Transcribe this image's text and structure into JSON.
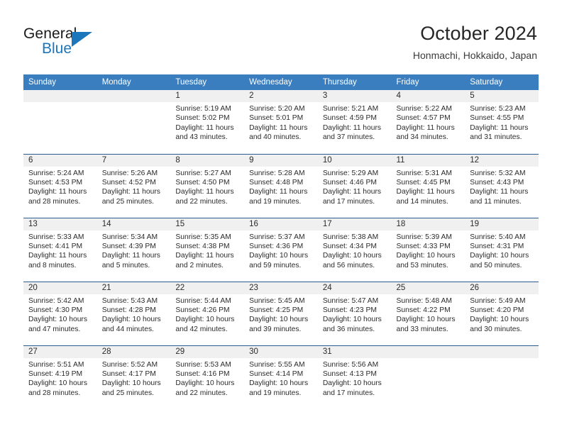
{
  "brand": {
    "name_part1": "General",
    "name_part2": "Blue",
    "logo_icon": "blue-triangle-icon",
    "colors": {
      "accent": "#1b76bc",
      "dark_text": "#1a1a1a"
    }
  },
  "header": {
    "title": "October 2024",
    "subtitle": "Honmachi, Hokkaido, Japan"
  },
  "theme": {
    "header_row_bg": "#3b7ebf",
    "header_row_text": "#ffffff",
    "row_divider": "#2b5c8f",
    "daynum_band_bg": "#f0f0f0",
    "page_bg": "#ffffff",
    "body_text": "#2b2b2b"
  },
  "calendar": {
    "weekday_headers": [
      "Sunday",
      "Monday",
      "Tuesday",
      "Wednesday",
      "Thursday",
      "Friday",
      "Saturday"
    ],
    "weeks": [
      [
        {
          "day": "",
          "lines": ""
        },
        {
          "day": "",
          "lines": ""
        },
        {
          "day": "1",
          "lines": "Sunrise: 5:19 AM\nSunset: 5:02 PM\nDaylight: 11 hours\nand 43 minutes."
        },
        {
          "day": "2",
          "lines": "Sunrise: 5:20 AM\nSunset: 5:01 PM\nDaylight: 11 hours\nand 40 minutes."
        },
        {
          "day": "3",
          "lines": "Sunrise: 5:21 AM\nSunset: 4:59 PM\nDaylight: 11 hours\nand 37 minutes."
        },
        {
          "day": "4",
          "lines": "Sunrise: 5:22 AM\nSunset: 4:57 PM\nDaylight: 11 hours\nand 34 minutes."
        },
        {
          "day": "5",
          "lines": "Sunrise: 5:23 AM\nSunset: 4:55 PM\nDaylight: 11 hours\nand 31 minutes."
        }
      ],
      [
        {
          "day": "6",
          "lines": "Sunrise: 5:24 AM\nSunset: 4:53 PM\nDaylight: 11 hours\nand 28 minutes."
        },
        {
          "day": "7",
          "lines": "Sunrise: 5:26 AM\nSunset: 4:52 PM\nDaylight: 11 hours\nand 25 minutes."
        },
        {
          "day": "8",
          "lines": "Sunrise: 5:27 AM\nSunset: 4:50 PM\nDaylight: 11 hours\nand 22 minutes."
        },
        {
          "day": "9",
          "lines": "Sunrise: 5:28 AM\nSunset: 4:48 PM\nDaylight: 11 hours\nand 19 minutes."
        },
        {
          "day": "10",
          "lines": "Sunrise: 5:29 AM\nSunset: 4:46 PM\nDaylight: 11 hours\nand 17 minutes."
        },
        {
          "day": "11",
          "lines": "Sunrise: 5:31 AM\nSunset: 4:45 PM\nDaylight: 11 hours\nand 14 minutes."
        },
        {
          "day": "12",
          "lines": "Sunrise: 5:32 AM\nSunset: 4:43 PM\nDaylight: 11 hours\nand 11 minutes."
        }
      ],
      [
        {
          "day": "13",
          "lines": "Sunrise: 5:33 AM\nSunset: 4:41 PM\nDaylight: 11 hours\nand 8 minutes."
        },
        {
          "day": "14",
          "lines": "Sunrise: 5:34 AM\nSunset: 4:39 PM\nDaylight: 11 hours\nand 5 minutes."
        },
        {
          "day": "15",
          "lines": "Sunrise: 5:35 AM\nSunset: 4:38 PM\nDaylight: 11 hours\nand 2 minutes."
        },
        {
          "day": "16",
          "lines": "Sunrise: 5:37 AM\nSunset: 4:36 PM\nDaylight: 10 hours\nand 59 minutes."
        },
        {
          "day": "17",
          "lines": "Sunrise: 5:38 AM\nSunset: 4:34 PM\nDaylight: 10 hours\nand 56 minutes."
        },
        {
          "day": "18",
          "lines": "Sunrise: 5:39 AM\nSunset: 4:33 PM\nDaylight: 10 hours\nand 53 minutes."
        },
        {
          "day": "19",
          "lines": "Sunrise: 5:40 AM\nSunset: 4:31 PM\nDaylight: 10 hours\nand 50 minutes."
        }
      ],
      [
        {
          "day": "20",
          "lines": "Sunrise: 5:42 AM\nSunset: 4:30 PM\nDaylight: 10 hours\nand 47 minutes."
        },
        {
          "day": "21",
          "lines": "Sunrise: 5:43 AM\nSunset: 4:28 PM\nDaylight: 10 hours\nand 44 minutes."
        },
        {
          "day": "22",
          "lines": "Sunrise: 5:44 AM\nSunset: 4:26 PM\nDaylight: 10 hours\nand 42 minutes."
        },
        {
          "day": "23",
          "lines": "Sunrise: 5:45 AM\nSunset: 4:25 PM\nDaylight: 10 hours\nand 39 minutes."
        },
        {
          "day": "24",
          "lines": "Sunrise: 5:47 AM\nSunset: 4:23 PM\nDaylight: 10 hours\nand 36 minutes."
        },
        {
          "day": "25",
          "lines": "Sunrise: 5:48 AM\nSunset: 4:22 PM\nDaylight: 10 hours\nand 33 minutes."
        },
        {
          "day": "26",
          "lines": "Sunrise: 5:49 AM\nSunset: 4:20 PM\nDaylight: 10 hours\nand 30 minutes."
        }
      ],
      [
        {
          "day": "27",
          "lines": "Sunrise: 5:51 AM\nSunset: 4:19 PM\nDaylight: 10 hours\nand 28 minutes."
        },
        {
          "day": "28",
          "lines": "Sunrise: 5:52 AM\nSunset: 4:17 PM\nDaylight: 10 hours\nand 25 minutes."
        },
        {
          "day": "29",
          "lines": "Sunrise: 5:53 AM\nSunset: 4:16 PM\nDaylight: 10 hours\nand 22 minutes."
        },
        {
          "day": "30",
          "lines": "Sunrise: 5:55 AM\nSunset: 4:14 PM\nDaylight: 10 hours\nand 19 minutes."
        },
        {
          "day": "31",
          "lines": "Sunrise: 5:56 AM\nSunset: 4:13 PM\nDaylight: 10 hours\nand 17 minutes."
        },
        {
          "day": "",
          "lines": ""
        },
        {
          "day": "",
          "lines": ""
        }
      ]
    ]
  }
}
